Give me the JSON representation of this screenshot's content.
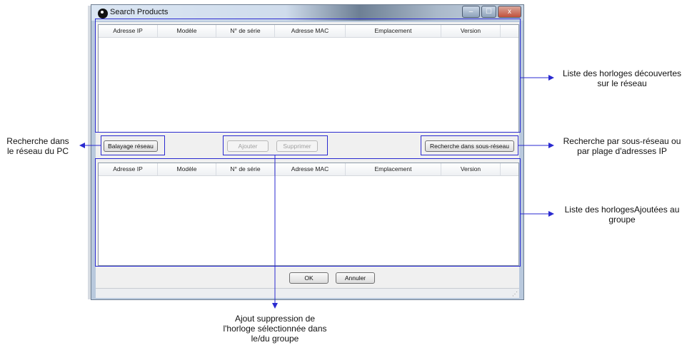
{
  "window": {
    "title": "Search Products",
    "controls": {
      "minimize": "‒",
      "maximize": "☐",
      "close": "x"
    }
  },
  "table_columns": [
    "Adresse IP",
    "Modèle",
    "N° de série",
    "Adresse MAC",
    "Emplacement",
    "Version"
  ],
  "buttons": {
    "scan": "Balayage réseau",
    "add": "Ajouter",
    "remove": "Supprimer",
    "subnet": "Recherche dans sous-réseau",
    "ok": "OK",
    "cancel": "Annuler"
  },
  "annotations": {
    "discovered_line1": "Liste des horloges découvertes",
    "discovered_line2": "sur le réseau",
    "scan_line1": "Recherche dans",
    "scan_line2": "le réseau du PC",
    "subnet_line1": "Recherche par sous-réseau ou",
    "subnet_line2": "par plage d'adresses IP",
    "added_line1": "Liste des horlogesAjoutées au",
    "added_line2": "groupe",
    "addremove_line1": "Ajout suppression de",
    "addremove_line2": "l'horloge sélectionnée dans",
    "addremove_line3": "le/du groupe"
  },
  "colors": {
    "annotation": "#2a2ad0",
    "window_frame": "#b9c9dd"
  }
}
